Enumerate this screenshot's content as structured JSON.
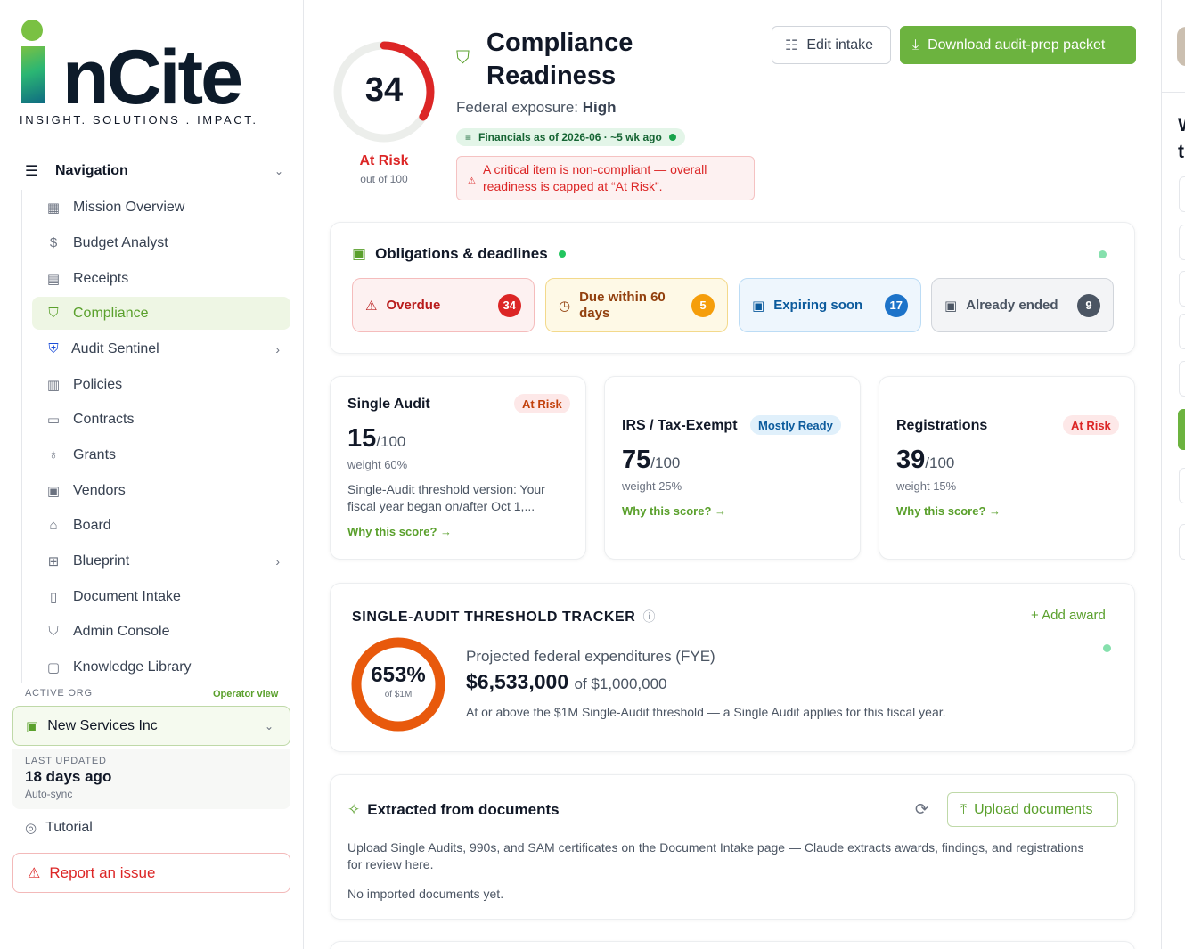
{
  "brand": {
    "word": "nCite",
    "tagline": "INSIGHT. SOLUTIONS . IMPACT."
  },
  "nav": {
    "title": "Navigation",
    "items": [
      {
        "label": "Mission Overview",
        "icon": "grid-icon"
      },
      {
        "label": "Budget Analyst",
        "icon": "dollar-icon"
      },
      {
        "label": "Receipts",
        "icon": "receipt-icon"
      },
      {
        "label": "Compliance",
        "icon": "shield-check-icon",
        "active": true
      },
      {
        "label": "Audit Sentinel",
        "icon": "shield-badge-icon",
        "has_children": true
      },
      {
        "label": "Policies",
        "icon": "scroll-icon"
      },
      {
        "label": "Contracts",
        "icon": "folder-icon"
      },
      {
        "label": "Grants",
        "icon": "award-icon"
      },
      {
        "label": "Vendors",
        "icon": "building-icon"
      },
      {
        "label": "Board",
        "icon": "landmark-icon"
      },
      {
        "label": "Blueprint",
        "icon": "sitemap-icon",
        "has_children": true
      },
      {
        "label": "Document Intake",
        "icon": "document-icon"
      },
      {
        "label": "Admin Console",
        "icon": "shield-alert-icon"
      },
      {
        "label": "Knowledge Library",
        "icon": "book-icon"
      }
    ]
  },
  "org": {
    "label": "ACTIVE ORG",
    "operator": "Operator view",
    "name": "New Services Inc",
    "updated_label": "LAST UPDATED",
    "updated_value": "18 days ago",
    "updated_sub": "Auto-sync"
  },
  "footer": {
    "tutorial": "Tutorial",
    "report": "Report an issue"
  },
  "readiness": {
    "score": "34",
    "score_value": 34,
    "max": 100,
    "status": "At Risk",
    "out_of": "out of 100",
    "title": "Compliance Readiness",
    "exposure_label": "Federal exposure:",
    "exposure_value": "High",
    "financials": "Financials as of 2026-06 · ~5 wk ago",
    "alert": "A critical item is non-compliant — overall readiness is capped at “At Risk”."
  },
  "actions": {
    "edit": "Edit intake",
    "download": "Download audit-prep packet"
  },
  "obligations": {
    "title": "Obligations & deadlines",
    "tiles": [
      {
        "label": "Overdue",
        "count": "34"
      },
      {
        "label": "Due within 60 days",
        "count": "5"
      },
      {
        "label": "Expiring soon",
        "count": "17"
      },
      {
        "label": "Already ended",
        "count": "9"
      }
    ]
  },
  "scores": [
    {
      "title": "Single Audit",
      "badge": "At Risk",
      "score": "15",
      "max": "/100",
      "weight": "weight 60%",
      "desc": "Single-Audit threshold version: Your fiscal year began on/after Oct 1,...",
      "link": "Why this score? →"
    },
    {
      "title": "IRS / Tax-Exempt",
      "badge": "Mostly Ready",
      "score": "75",
      "max": "/100",
      "weight": "weight 25%",
      "link": "Why this score? →"
    },
    {
      "title": "Registrations",
      "badge": "At Risk",
      "score": "39",
      "max": "/100",
      "weight": "weight 15%",
      "link": "Why this score? →"
    }
  ],
  "tracker": {
    "title": "SINGLE-AUDIT THRESHOLD TRACKER",
    "add": "Add award",
    "pct": "653%",
    "pct_sub": "of $1M",
    "proj_label": "Projected federal expenditures (FYE)",
    "proj_value": "$6,533,000",
    "proj_of": "of $1,000,000",
    "note": "At or above the $1M Single-Audit threshold — a Single Audit applies for this fiscal year."
  },
  "extracted": {
    "title": "Extracted from documents",
    "upload": "Upload documents",
    "desc": "Upload Single Audits, 990s, and SAM certificates on the Document Intake page — Claude extracts awards, findings, and registrations for review here.",
    "empty": "No imported documents yet."
  },
  "right_panel": {
    "text": "W t"
  },
  "colors": {
    "brand_green": "#6cb33f",
    "risk_red": "#dc2626",
    "tracker_orange": "#e8590c"
  }
}
